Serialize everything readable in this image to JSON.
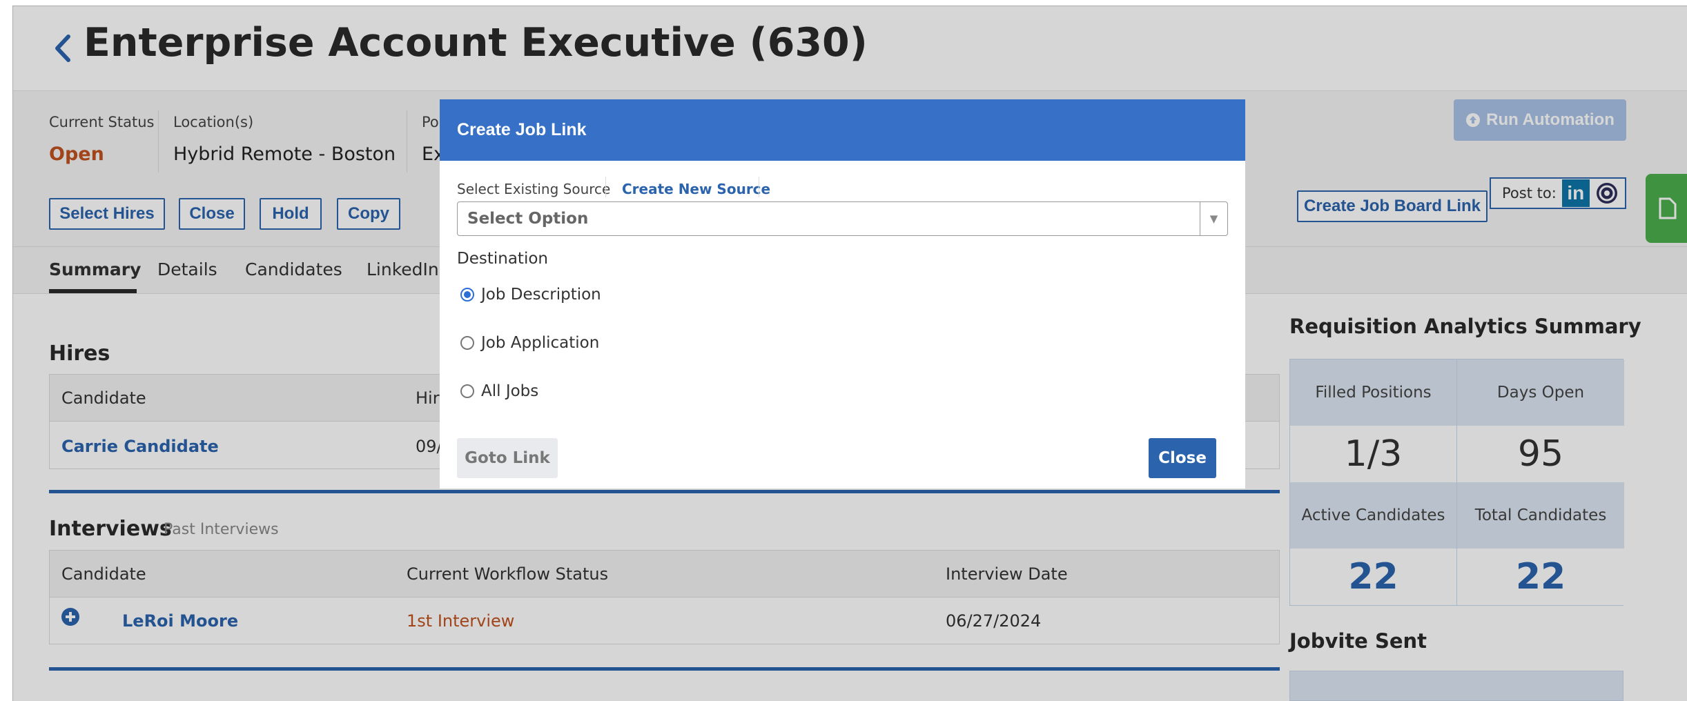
{
  "page": {
    "title": "Enterprise Account Executive (630)"
  },
  "meta": {
    "status_label": "Current Status",
    "status_value": "Open",
    "location_label": "Location(s)",
    "location_value": "Hybrid Remote - Boston",
    "position_label_partial": "Po",
    "position_value_partial": "Ex"
  },
  "actions": {
    "select_hires": "Select Hires",
    "close": "Close",
    "hold": "Hold",
    "copy": "Copy",
    "run_automation": "Run Automation",
    "create_job_board_link": "Create Job Board Link",
    "post_to": "Post to:"
  },
  "tabs": [
    "Summary",
    "Details",
    "Candidates",
    "LinkedIn R"
  ],
  "hires": {
    "title": "Hires",
    "columns": [
      "Candidate",
      "Hire"
    ],
    "rows": [
      {
        "candidate": "Carrie Candidate",
        "date": "09/"
      }
    ]
  },
  "interviews": {
    "title": "Interviews",
    "past_link": "Past Interviews",
    "columns": [
      "Candidate",
      "Current Workflow Status",
      "Interview Date"
    ],
    "rows": [
      {
        "candidate": "LeRoi Moore",
        "status": "1st Interview",
        "date": "06/27/2024"
      }
    ]
  },
  "analytics": {
    "title": "Requisition Analytics Summary",
    "filled_label": "Filled Positions",
    "filled_value": "1/3",
    "days_label": "Days Open",
    "days_value": "95",
    "active_label": "Active Candidates",
    "active_value": "22",
    "total_label": "Total Candidates",
    "total_value": "22",
    "jobvite_title": "Jobvite Sent"
  },
  "modal": {
    "title": "Create Job Link",
    "tab_existing": "Select Existing Source",
    "tab_new": "Create New Source",
    "select_placeholder": "Select Option",
    "destination_label": "Destination",
    "options": [
      "Job Description",
      "Job Application",
      "All Jobs"
    ],
    "selected": "Job Description",
    "goto_label": "Goto Link",
    "close_label": "Close"
  },
  "colors": {
    "brand_blue": "#2c63ad",
    "modal_header": "#3670c7",
    "status_orange": "#c0521f",
    "linkedin": "#0e76a8",
    "side_tab_green": "#4cae4c"
  }
}
